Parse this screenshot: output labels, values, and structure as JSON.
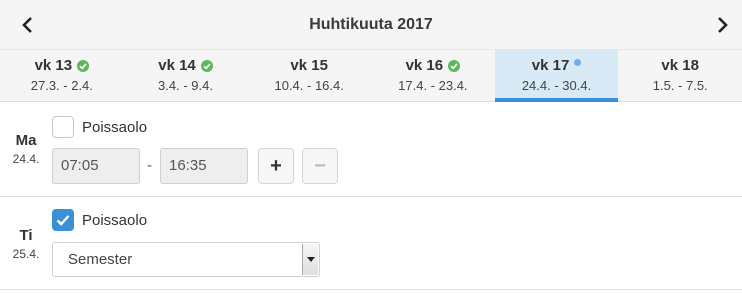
{
  "header": {
    "title": "Huhtikuuta 2017",
    "prev_icon": "chevron-left-icon",
    "next_icon": "chevron-right-icon"
  },
  "weeks": [
    {
      "label": "vk 13",
      "range": "27.3. - 2.4.",
      "status": "complete"
    },
    {
      "label": "vk 14",
      "range": "3.4. - 9.4.",
      "status": "complete"
    },
    {
      "label": "vk 15",
      "range": "10.4. - 16.4.",
      "status": "none"
    },
    {
      "label": "vk 16",
      "range": "17.4. - 23.4.",
      "status": "complete"
    },
    {
      "label": "vk 17",
      "range": "24.4. - 30.4.",
      "status": "current"
    },
    {
      "label": "vk 18",
      "range": "1.5. - 7.5.",
      "status": "none"
    }
  ],
  "days": [
    {
      "name": "Ma",
      "date": "24.4.",
      "absence_label": "Poissaolo",
      "absence_checked": false,
      "start_time": "07:05",
      "separator": "-",
      "end_time": "16:35",
      "add_label": "+",
      "remove_label": "−"
    },
    {
      "name": "Ti",
      "date": "25.4.",
      "absence_label": "Poissaolo",
      "absence_checked": true,
      "absence_reason": "Semester"
    }
  ],
  "colors": {
    "accent": "#3b8fd4",
    "check_green": "#5cb85c",
    "active_week_bg": "#d8eaf5",
    "current_dot": "#6fb0e6"
  }
}
